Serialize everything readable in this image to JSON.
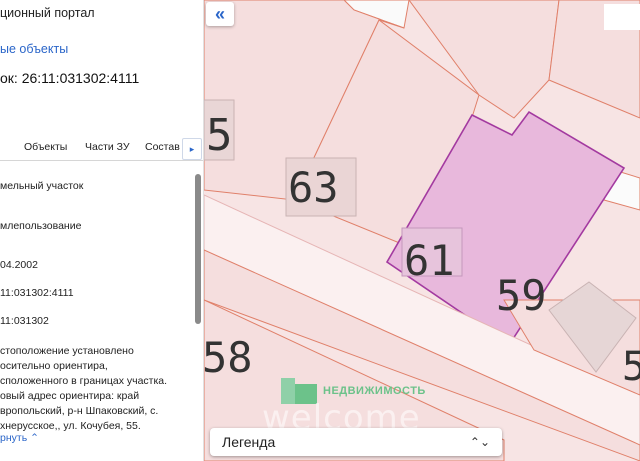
{
  "sidebar": {
    "portal_title": "ционный портал",
    "objects_link": "ые объекты",
    "parcel_line": "ок: 26:11:031302:4111",
    "tabs": [
      "",
      "Объекты",
      "Части ЗУ",
      "Состав"
    ],
    "tab_scroll_icon": "triangle-right-icon",
    "info_lines": [
      "мельный участок",
      "млепользование",
      "04.2002",
      "11:031302:4111",
      "11:031302"
    ],
    "address_lines": [
      "стоположение установлено",
      "осительно ориентира,",
      "сположенного в границах участка.",
      "овый адрес ориентира: край",
      "вропольский, р-н Шпаковский, с.",
      "хнерусское,, ул. Кочубея, 55."
    ],
    "collapse_label": "рнуть",
    "collapse_icon": "chevron-up-icon"
  },
  "map": {
    "collapse_icon": "double-chevron-left-icon",
    "house_numbers": [
      "5",
      "63",
      "61",
      "59",
      "58",
      "5"
    ],
    "selected_parcel_color": "#e8b8dc",
    "selected_border_color": "#a33aa0",
    "parcel_border_color": "#e0806a",
    "road_color": "#fbf0f0",
    "watermark_brand": "НЕДВИЖИМОСТЬ",
    "watermark_text": "welcome",
    "legend_label": "Легенда",
    "legend_icon": "up-down-chevron-icon"
  }
}
